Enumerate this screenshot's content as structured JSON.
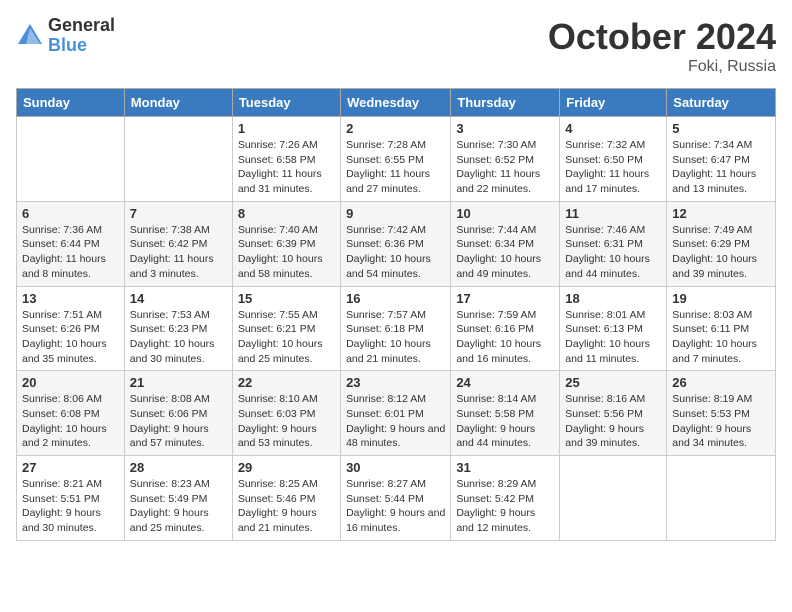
{
  "header": {
    "logo_general": "General",
    "logo_blue": "Blue",
    "month": "October 2024",
    "location": "Foki, Russia"
  },
  "days_of_week": [
    "Sunday",
    "Monday",
    "Tuesday",
    "Wednesday",
    "Thursday",
    "Friday",
    "Saturday"
  ],
  "weeks": [
    [
      {
        "day": "",
        "info": ""
      },
      {
        "day": "",
        "info": ""
      },
      {
        "day": "1",
        "info": "Sunrise: 7:26 AM\nSunset: 6:58 PM\nDaylight: 11 hours and 31 minutes."
      },
      {
        "day": "2",
        "info": "Sunrise: 7:28 AM\nSunset: 6:55 PM\nDaylight: 11 hours and 27 minutes."
      },
      {
        "day": "3",
        "info": "Sunrise: 7:30 AM\nSunset: 6:52 PM\nDaylight: 11 hours and 22 minutes."
      },
      {
        "day": "4",
        "info": "Sunrise: 7:32 AM\nSunset: 6:50 PM\nDaylight: 11 hours and 17 minutes."
      },
      {
        "day": "5",
        "info": "Sunrise: 7:34 AM\nSunset: 6:47 PM\nDaylight: 11 hours and 13 minutes."
      }
    ],
    [
      {
        "day": "6",
        "info": "Sunrise: 7:36 AM\nSunset: 6:44 PM\nDaylight: 11 hours and 8 minutes."
      },
      {
        "day": "7",
        "info": "Sunrise: 7:38 AM\nSunset: 6:42 PM\nDaylight: 11 hours and 3 minutes."
      },
      {
        "day": "8",
        "info": "Sunrise: 7:40 AM\nSunset: 6:39 PM\nDaylight: 10 hours and 58 minutes."
      },
      {
        "day": "9",
        "info": "Sunrise: 7:42 AM\nSunset: 6:36 PM\nDaylight: 10 hours and 54 minutes."
      },
      {
        "day": "10",
        "info": "Sunrise: 7:44 AM\nSunset: 6:34 PM\nDaylight: 10 hours and 49 minutes."
      },
      {
        "day": "11",
        "info": "Sunrise: 7:46 AM\nSunset: 6:31 PM\nDaylight: 10 hours and 44 minutes."
      },
      {
        "day": "12",
        "info": "Sunrise: 7:49 AM\nSunset: 6:29 PM\nDaylight: 10 hours and 39 minutes."
      }
    ],
    [
      {
        "day": "13",
        "info": "Sunrise: 7:51 AM\nSunset: 6:26 PM\nDaylight: 10 hours and 35 minutes."
      },
      {
        "day": "14",
        "info": "Sunrise: 7:53 AM\nSunset: 6:23 PM\nDaylight: 10 hours and 30 minutes."
      },
      {
        "day": "15",
        "info": "Sunrise: 7:55 AM\nSunset: 6:21 PM\nDaylight: 10 hours and 25 minutes."
      },
      {
        "day": "16",
        "info": "Sunrise: 7:57 AM\nSunset: 6:18 PM\nDaylight: 10 hours and 21 minutes."
      },
      {
        "day": "17",
        "info": "Sunrise: 7:59 AM\nSunset: 6:16 PM\nDaylight: 10 hours and 16 minutes."
      },
      {
        "day": "18",
        "info": "Sunrise: 8:01 AM\nSunset: 6:13 PM\nDaylight: 10 hours and 11 minutes."
      },
      {
        "day": "19",
        "info": "Sunrise: 8:03 AM\nSunset: 6:11 PM\nDaylight: 10 hours and 7 minutes."
      }
    ],
    [
      {
        "day": "20",
        "info": "Sunrise: 8:06 AM\nSunset: 6:08 PM\nDaylight: 10 hours and 2 minutes."
      },
      {
        "day": "21",
        "info": "Sunrise: 8:08 AM\nSunset: 6:06 PM\nDaylight: 9 hours and 57 minutes."
      },
      {
        "day": "22",
        "info": "Sunrise: 8:10 AM\nSunset: 6:03 PM\nDaylight: 9 hours and 53 minutes."
      },
      {
        "day": "23",
        "info": "Sunrise: 8:12 AM\nSunset: 6:01 PM\nDaylight: 9 hours and 48 minutes."
      },
      {
        "day": "24",
        "info": "Sunrise: 8:14 AM\nSunset: 5:58 PM\nDaylight: 9 hours and 44 minutes."
      },
      {
        "day": "25",
        "info": "Sunrise: 8:16 AM\nSunset: 5:56 PM\nDaylight: 9 hours and 39 minutes."
      },
      {
        "day": "26",
        "info": "Sunrise: 8:19 AM\nSunset: 5:53 PM\nDaylight: 9 hours and 34 minutes."
      }
    ],
    [
      {
        "day": "27",
        "info": "Sunrise: 8:21 AM\nSunset: 5:51 PM\nDaylight: 9 hours and 30 minutes."
      },
      {
        "day": "28",
        "info": "Sunrise: 8:23 AM\nSunset: 5:49 PM\nDaylight: 9 hours and 25 minutes."
      },
      {
        "day": "29",
        "info": "Sunrise: 8:25 AM\nSunset: 5:46 PM\nDaylight: 9 hours and 21 minutes."
      },
      {
        "day": "30",
        "info": "Sunrise: 8:27 AM\nSunset: 5:44 PM\nDaylight: 9 hours and 16 minutes."
      },
      {
        "day": "31",
        "info": "Sunrise: 8:29 AM\nSunset: 5:42 PM\nDaylight: 9 hours and 12 minutes."
      },
      {
        "day": "",
        "info": ""
      },
      {
        "day": "",
        "info": ""
      }
    ]
  ]
}
